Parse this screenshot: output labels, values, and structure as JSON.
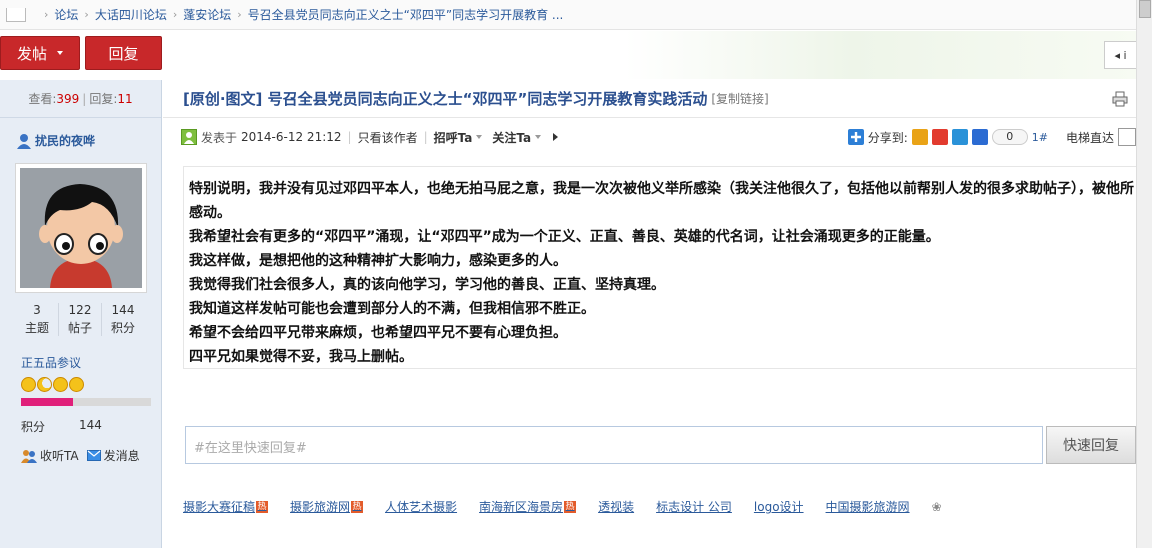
{
  "breadcrumb": {
    "items": [
      "论坛",
      "大话四川论坛",
      "蓬安论坛",
      "号召全县党员同志向正义之士“邓四平”同志学习开展教育 ..."
    ]
  },
  "toolbar": {
    "post_label": "发帖",
    "reply_label": "回复",
    "prev_label": "◂ i"
  },
  "sidebar": {
    "views_label": "查看:",
    "views": "399",
    "replies_label": "回复:",
    "replies": "11",
    "author_name": "扰民的夜哗",
    "stats": [
      {
        "value": "3",
        "label": "主题"
      },
      {
        "value": "122",
        "label": "帖子"
      },
      {
        "value": "144",
        "label": "积分"
      }
    ],
    "rank": "正五品参议",
    "progress_fraction": 0.4,
    "points_label": "积分",
    "points_value": "144",
    "follow_label": "收听TA",
    "message_label": "发消息"
  },
  "post": {
    "title": "[原创·图文] 号召全县党员同志向正义之士“邓四平”同志学习开展教育实践活动",
    "copy_link": "[复制链接]",
    "posted_label": "发表于",
    "posted_time": "2014-6-12 21:12",
    "only_author": "只看该作者",
    "greet": "招呼Ta",
    "follow": "关注Ta",
    "share_label": "分享到:",
    "share_count": "0",
    "floor": "1#",
    "elevator": "电梯直达",
    "body": [
      "特别说明，我并没有见过邓四平本人，也绝无拍马屁之意，我是一次次被他义举所感染（我关注他很久了，包括他以前帮别人发的很多求助帖子），被他所感动。",
      "我希望社会有更多的“邓四平”涌现，让“邓四平”成为一个正义、正直、善良、英雄的代名词，让社会涌现更多的正能量。",
      "我这样做，是想把他的这种精神扩大影响力，感染更多的人。",
      "我觉得我们社会很多人，真的该向他学习，学习他的善良、正直、坚持真理。",
      "我知道这样发帖可能也会遭到部分人的不满，但我相信邪不胜正。",
      "希望不会给四平兄带来麻烦，也希望四平兄不要有心理负担。",
      "四平兄如果觉得不妥，我马上删帖。"
    ]
  },
  "quick_reply": {
    "placeholder": "#在这里快速回复#",
    "button": "快速回复"
  },
  "ads": [
    "摄影大赛征稿",
    "摄影旅游网",
    "人体艺术摄影",
    "南海新区海景房",
    "透视装",
    "标志设计 公司",
    "logo设计",
    "中国摄影旅游网"
  ],
  "ad_hot_mark": "热"
}
